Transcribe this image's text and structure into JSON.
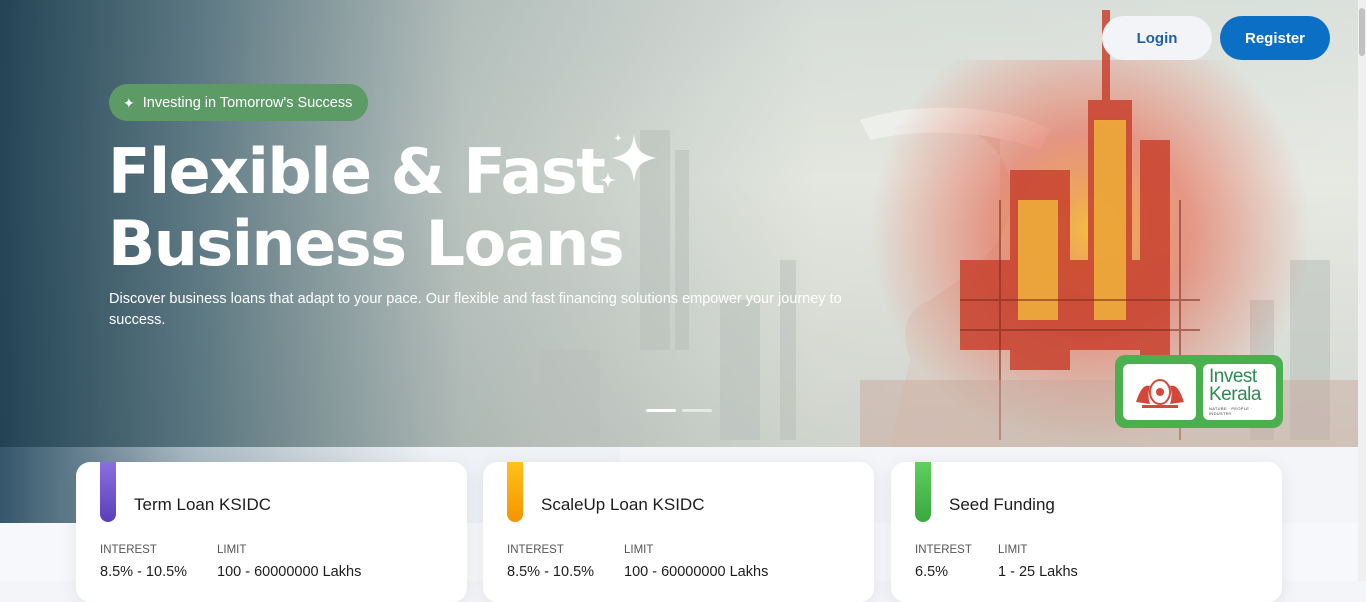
{
  "nav": {
    "login_label": "Login",
    "register_label": "Register"
  },
  "hero": {
    "badge_icon": "sparkle-icon",
    "badge_text": "Investing in Tomorrow's Success",
    "headline_line1": "Flexible & Fast",
    "headline_line2": "Business Loans",
    "subtext": "Discover business loans that adapt to your pace. Our flexible and fast financing solutions empower your journey to success.",
    "slides": {
      "count": 2,
      "active": 0
    }
  },
  "partner_logos": {
    "left": "kerala-emblem-logo",
    "right_line1": "Invest",
    "right_line2": "Kerala",
    "right_tagline": "NATURE · PEOPLE · INDUSTRY"
  },
  "cards": [
    {
      "title": "Term Loan KSIDC",
      "interest_label": "INTEREST",
      "interest": "8.5% - 10.5%",
      "limit_label": "LIMIT",
      "limit": "100 - 60000000 Lakhs",
      "accent": "#6a4fc9"
    },
    {
      "title": "ScaleUp Loan KSIDC",
      "interest_label": "INTEREST",
      "interest": "8.5% - 10.5%",
      "limit_label": "LIMIT",
      "limit": "100 - 60000000 Lakhs",
      "accent": "#f5a400"
    },
    {
      "title": "Seed Funding",
      "interest_label": "INTEREST",
      "interest": "6.5%",
      "limit_label": "LIMIT",
      "limit": "1 - 25 Lakhs",
      "accent": "#4cb84f"
    }
  ],
  "colors": {
    "primary": "#0b6fc6",
    "badge": "#5c9a66",
    "logo_frame": "#49b04d"
  }
}
